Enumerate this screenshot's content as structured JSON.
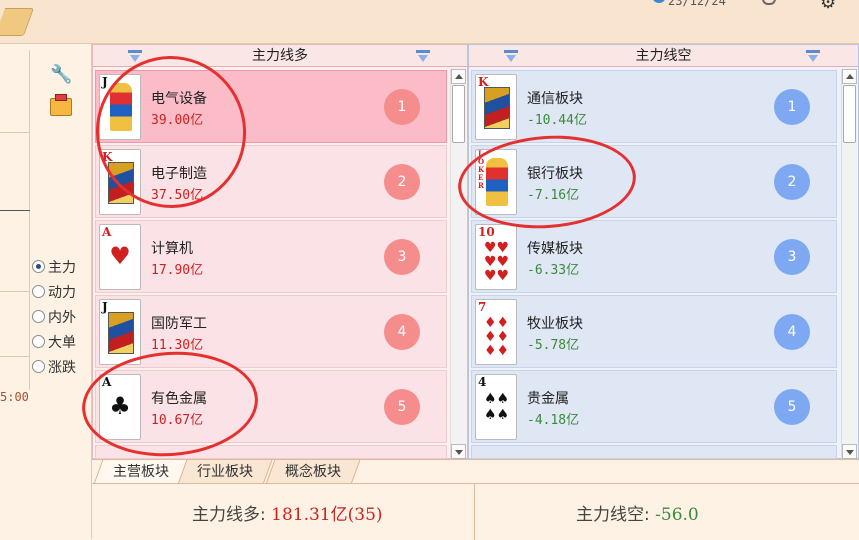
{
  "topbar": {
    "date": "23/12/24"
  },
  "left_panel": {
    "radios": [
      {
        "label": "主力",
        "checked": true
      },
      {
        "label": "动力",
        "checked": false
      },
      {
        "label": "内外",
        "checked": false
      },
      {
        "label": "大单",
        "checked": false
      },
      {
        "label": "涨跌",
        "checked": false
      }
    ],
    "time": "5:00"
  },
  "long_column": {
    "title": "主力线多",
    "rows": [
      {
        "card": "J",
        "name": "电气设备",
        "value": "39.00亿",
        "rank": "1"
      },
      {
        "card": "K",
        "name": "电子制造",
        "value": "37.50亿",
        "rank": "2"
      },
      {
        "card": "A",
        "name": "计算机",
        "value": "17.90亿",
        "rank": "3"
      },
      {
        "card": "J",
        "name": "国防军工",
        "value": "11.30亿",
        "rank": "4"
      },
      {
        "card": "A",
        "name": "有色金属",
        "value": "10.67亿",
        "rank": "5"
      }
    ]
  },
  "short_column": {
    "title": "主力线空",
    "rows": [
      {
        "card": "K",
        "name": "通信板块",
        "value": "-10.44亿",
        "rank": "1"
      },
      {
        "card": "JOKER",
        "name": "银行板块",
        "value": "-7.16亿",
        "rank": "2"
      },
      {
        "card": "10",
        "name": "传媒板块",
        "value": "-6.33亿",
        "rank": "3"
      },
      {
        "card": "7",
        "name": "牧业板块",
        "value": "-5.78亿",
        "rank": "4"
      },
      {
        "card": "4",
        "name": "贵金属",
        "value": "-4.18亿",
        "rank": "5"
      }
    ]
  },
  "tabs": [
    "主营板块",
    "行业板块",
    "概念板块"
  ],
  "footer": {
    "long_label": "主力线多:",
    "long_value": "181.31亿(35)",
    "short_label": "主力线空:",
    "short_value": "-56.0"
  }
}
